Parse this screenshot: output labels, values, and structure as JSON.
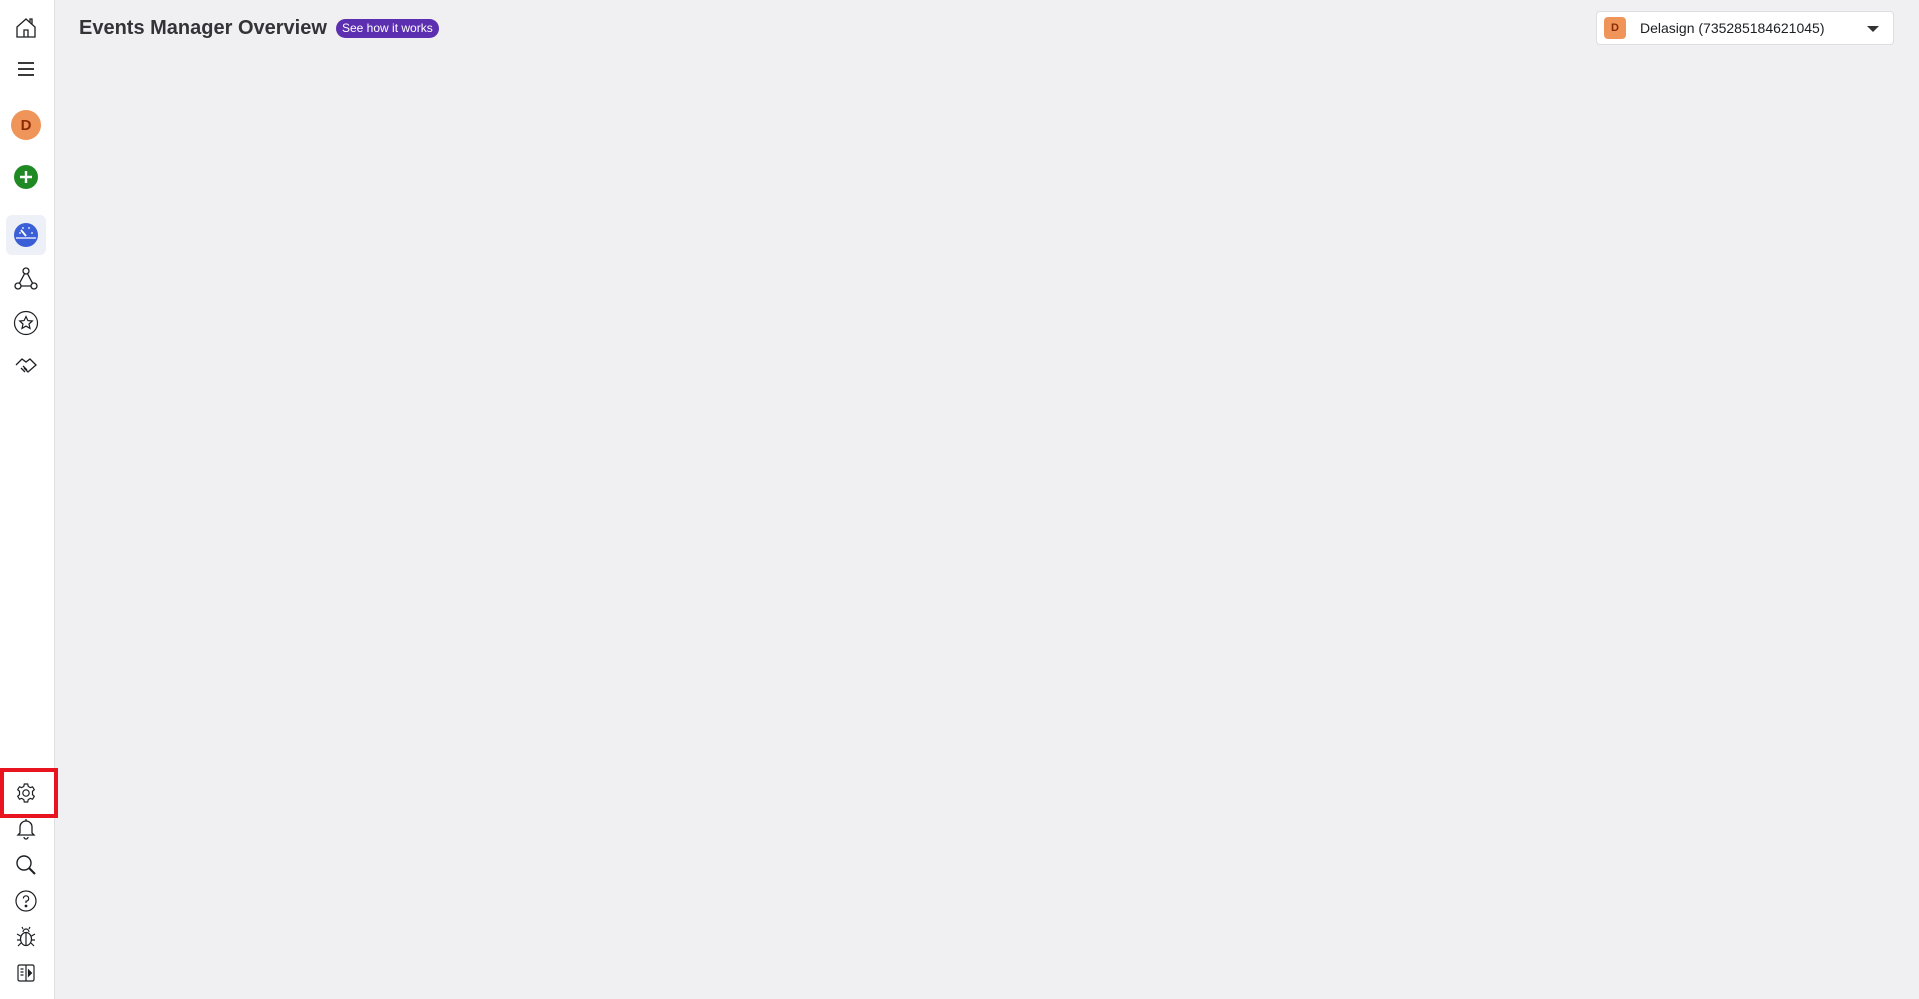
{
  "header": {
    "title": "Events Manager Overview",
    "help_label": "See how it works"
  },
  "account_selector": {
    "initial": "D",
    "name": "Delasign (735285184621045)"
  },
  "sidebar": {
    "profile_initial": "D",
    "top_items": [
      {
        "name": "home",
        "icon": "home-icon"
      },
      {
        "name": "menu",
        "icon": "hamburger-icon"
      },
      {
        "name": "profile",
        "icon": "avatar"
      },
      {
        "name": "create",
        "icon": "plus-circle-icon"
      },
      {
        "name": "overview",
        "icon": "dashboard-gauge-icon",
        "active": true
      },
      {
        "name": "data-sources",
        "icon": "network-icon"
      },
      {
        "name": "custom-conversions",
        "icon": "star-circle-icon"
      },
      {
        "name": "partner-integrations",
        "icon": "handshake-icon"
      }
    ],
    "bottom_items": [
      {
        "name": "settings",
        "icon": "gear-icon",
        "highlighted": true
      },
      {
        "name": "notifications",
        "icon": "bell-icon"
      },
      {
        "name": "search",
        "icon": "search-icon"
      },
      {
        "name": "help",
        "icon": "help-icon"
      },
      {
        "name": "report-bug",
        "icon": "bug-icon"
      },
      {
        "name": "toggle-panel",
        "icon": "panel-toggle-icon"
      }
    ]
  },
  "colors": {
    "accent": "#5b2fb0",
    "avatar": "#f0955a",
    "active_nav": "#3b5fd6",
    "create": "#1f8a24",
    "highlight": "#e8141f"
  }
}
